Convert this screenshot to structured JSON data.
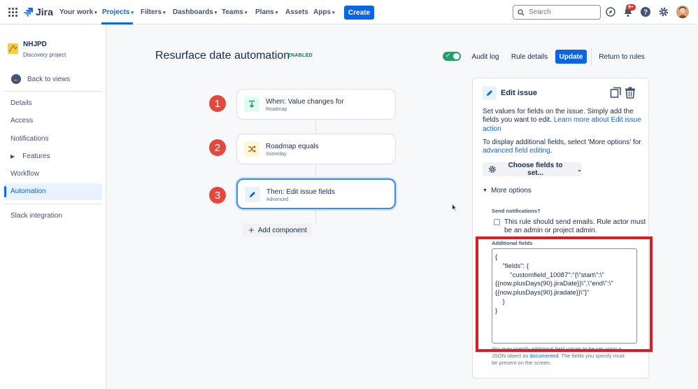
{
  "topnav": {
    "logo_text": "Jira",
    "items": [
      {
        "label": "Your work"
      },
      {
        "label": "Projects"
      },
      {
        "label": "Filters"
      },
      {
        "label": "Dashboards"
      },
      {
        "label": "Teams"
      },
      {
        "label": "Plans"
      },
      {
        "label": "Assets"
      },
      {
        "label": "Apps"
      }
    ],
    "create_label": "Create",
    "search_placeholder": "Search",
    "notification_badge": "9+"
  },
  "sidebar": {
    "project_name": "NHJPD",
    "project_type": "Discovery project",
    "back_label": "Back to views",
    "items": [
      {
        "label": "Details"
      },
      {
        "label": "Access"
      },
      {
        "label": "Notifications"
      },
      {
        "label": "Features"
      },
      {
        "label": "Workflow"
      },
      {
        "label": "Automation"
      },
      {
        "label": "Slack integration"
      }
    ]
  },
  "header": {
    "title": "Resurface date automation",
    "status": "ENABLED",
    "audit_log": "Audit log",
    "rule_details": "Rule details",
    "update": "Update",
    "return": "Return to rules"
  },
  "steps": [
    {
      "num": "1",
      "title": "When: Value changes for",
      "sub": "Roadmap"
    },
    {
      "num": "2",
      "title": "Roadmap equals",
      "sub": "Someday"
    },
    {
      "num": "3",
      "title": "Then: Edit issue fields",
      "sub": "Advanced"
    }
  ],
  "add_component": "Add component",
  "panel": {
    "title": "Edit issue",
    "desc1": "Set values for fields on the issue. Simply add the",
    "desc2_pre": "fields you want to edit. ",
    "desc2_link": "Learn more about Edit issue",
    "desc3_link": "action",
    "desc4": "To display additional fields, select 'More options' for",
    "desc5_link": "advanced field editing",
    "desc5_post": ".",
    "choose_fields": "Choose fields to set...",
    "more_options": "More options",
    "send_notifications_label": "Send notifications?",
    "send_notifications_text1": "This rule should send emails. Rule actor must",
    "send_notifications_text2": "be an admin or project admin.",
    "additional_fields_label": "Additional fields",
    "additional_fields_value": "{\n    \"fields\": {\n        \"customfield_10087\":\"{\\\"start\\\":\\\"\n{{now.plusDays(90).jiraDate}}\\\",\\\"end\\\":\\\"\n{{now.plusDays(90).jiradate}}\\\"}\"\n    }\n}",
    "helper_pre": "You may specify additional field values to be set using a",
    "helper_mid_pre": "JSON object as ",
    "helper_link": "documented",
    "helper_mid_post": ". The fields you specify must",
    "helper_end": "be present on the screen."
  },
  "colors": {
    "brand_blue": "#0c66e4",
    "step_red": "#e2483d",
    "highlight_red": "#d91f26",
    "toggle_green": "#22a06b"
  }
}
